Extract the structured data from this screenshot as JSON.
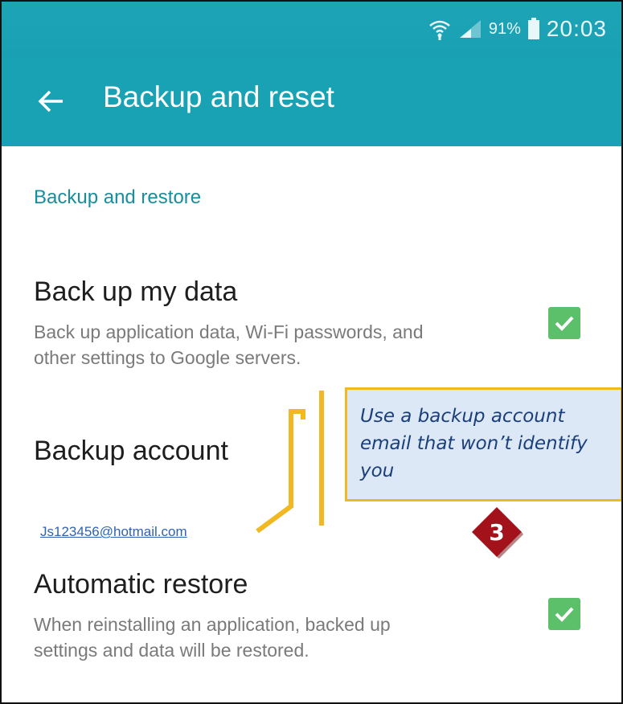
{
  "status_bar": {
    "battery_percent": "91%",
    "time": "20:03",
    "icons": [
      "wifi-icon",
      "signal-icon",
      "battery-icon"
    ]
  },
  "app_bar": {
    "title": "Backup and reset",
    "back_icon": "arrow-left-icon"
  },
  "section": {
    "header": "Backup and restore"
  },
  "rows": [
    {
      "title": "Back up my data",
      "subtitle_line1": "Back up application data, Wi-Fi passwords, and",
      "subtitle_line2": "other settings to Google servers.",
      "checked": true
    },
    {
      "title": "Backup account",
      "value": "Js123456@hotmail.com"
    },
    {
      "title": "Automatic restore",
      "subtitle_line1": "When reinstalling an application, backed up",
      "subtitle_line2": "settings and data will be restored.",
      "checked": true
    }
  ],
  "annotation": {
    "callout_line1": "Use a backup account",
    "callout_line2": "email that won’t identify",
    "callout_line3": "you",
    "step_number": "3"
  },
  "colors": {
    "accent": "#19a1b4",
    "checkbox": "#5cbf6a",
    "callout_border": "#f2b822",
    "badge": "#a3121b"
  }
}
